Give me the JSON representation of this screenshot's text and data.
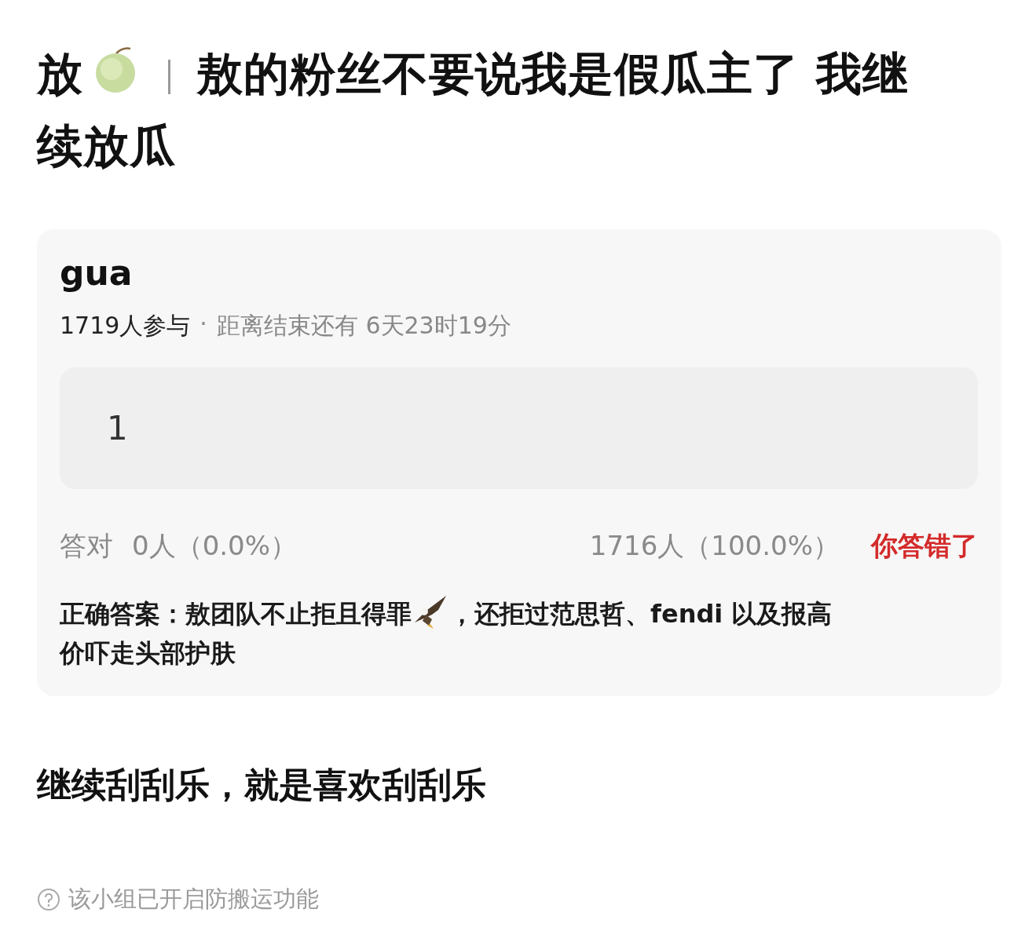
{
  "title": {
    "lead": "放",
    "lines": [
      "敖的粉丝不要说我是假瓜主了 我继",
      "续放瓜"
    ]
  },
  "poll": {
    "title": "gua",
    "participants": "1719人参与",
    "separator": "·",
    "remaining": "距离结束还有 6天23时19分",
    "options": [
      {
        "label": "1",
        "selected": false
      }
    ],
    "stats": {
      "correct_label": "答对",
      "correct_count": "0人（0.0%）",
      "wrong_count": "1716人（100.0%）",
      "result": "你答错了"
    },
    "answer": {
      "before": "正确答案：敖团队不止拒且得罪",
      "after": "，还拒过范思哲、fendi 以及报高",
      "rest": "价吓走头部护肤"
    }
  },
  "body": "继续刮刮乐，就是喜欢刮刮乐",
  "footer": "该小组已开启防搬运功能"
}
